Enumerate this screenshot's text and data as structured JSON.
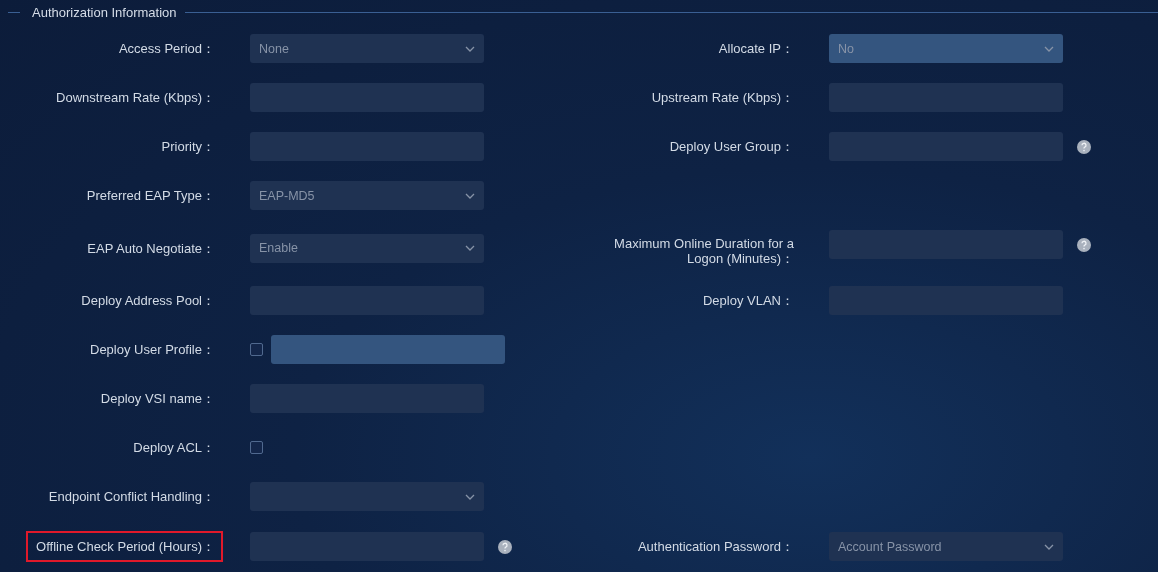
{
  "section": {
    "title": "Authorization Information"
  },
  "rows": [
    {
      "left": {
        "label": "Access Period：",
        "kind": "select",
        "value": "None",
        "disabled": false,
        "help": false
      },
      "right": {
        "label": "Allocate IP：",
        "kind": "select",
        "value": "No",
        "disabled": true,
        "help": false
      }
    },
    {
      "left": {
        "label": "Downstream Rate (Kbps)：",
        "kind": "input",
        "disabled": false,
        "help": false
      },
      "right": {
        "label": "Upstream Rate (Kbps)：",
        "kind": "input",
        "disabled": false,
        "help": false
      }
    },
    {
      "left": {
        "label": "Priority：",
        "kind": "input",
        "disabled": false,
        "help": false
      },
      "right": {
        "label": "Deploy User Group：",
        "kind": "input",
        "disabled": false,
        "help": true
      }
    },
    {
      "left": {
        "label": "Preferred EAP Type：",
        "kind": "select",
        "value": "EAP-MD5",
        "disabled": false,
        "help": false
      }
    },
    {
      "left": {
        "label": "EAP Auto Negotiate：",
        "kind": "select",
        "value": "Enable",
        "disabled": false,
        "help": false
      },
      "right": {
        "label": "Maximum Online Duration for a Logon (Minutes)：",
        "kind": "input",
        "disabled": false,
        "help": true
      }
    },
    {
      "left": {
        "label": "Deploy Address Pool：",
        "kind": "input",
        "disabled": false,
        "help": false
      },
      "right": {
        "label": "Deploy VLAN：",
        "kind": "input",
        "disabled": false,
        "help": false
      }
    },
    {
      "left": {
        "label": "Deploy User Profile：",
        "kind": "checkbox_input",
        "checked": false,
        "disabled": true,
        "help": false
      }
    },
    {
      "left": {
        "label": "Deploy VSI name：",
        "kind": "input",
        "disabled": false,
        "help": false
      }
    },
    {
      "left": {
        "label": "Deploy ACL：",
        "kind": "checkbox",
        "checked": false,
        "help": false
      }
    },
    {
      "left": {
        "label": "Endpoint Conflict Handling：",
        "kind": "select",
        "disabled": false,
        "help": false
      }
    },
    {
      "left": {
        "label": "Offline Check Period (Hours)：",
        "kind": "input",
        "disabled": false,
        "help": true,
        "highlighted": true
      },
      "right": {
        "label": "Authentication Password：",
        "kind": "select",
        "value": "Account Password",
        "disabled": false,
        "help": false
      }
    }
  ]
}
